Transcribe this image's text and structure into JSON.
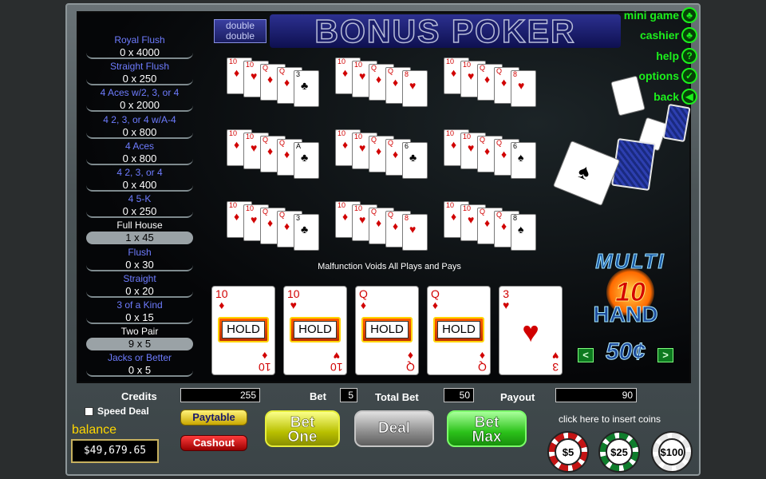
{
  "title": {
    "small_line1": "double",
    "small_line2": "double",
    "main": "BONUS POKER"
  },
  "paytable": [
    {
      "name": "Royal Flush",
      "payout": "0 x 4000",
      "active": false
    },
    {
      "name": "Straight Flush",
      "payout": "0 x 250",
      "active": false
    },
    {
      "name": "4 Aces w/2, 3, or 4",
      "payout": "0 x 2000",
      "active": false
    },
    {
      "name": "4 2, 3, or 4 w/A-4",
      "payout": "0 x 800",
      "active": false
    },
    {
      "name": "4 Aces",
      "payout": "0 x 800",
      "active": false
    },
    {
      "name": "4 2, 3, or 4",
      "payout": "0 x 400",
      "active": false
    },
    {
      "name": "4 5-K",
      "payout": "0 x 250",
      "active": false
    },
    {
      "name": "Full House",
      "payout": "1 x 45",
      "active": true
    },
    {
      "name": "Flush",
      "payout": "0 x 30",
      "active": false
    },
    {
      "name": "Straight",
      "payout": "0 x 20",
      "active": false
    },
    {
      "name": "3 of a Kind",
      "payout": "0 x 15",
      "active": false
    },
    {
      "name": "Two Pair",
      "payout": "9 x 5",
      "active": true
    },
    {
      "name": "Jacks or Better",
      "payout": "0 x 5",
      "active": false
    }
  ],
  "menu": [
    {
      "label": "mini game",
      "icon": "clover-icon",
      "glyph": "♣"
    },
    {
      "label": "cashier",
      "icon": "clover-icon",
      "glyph": "♣"
    },
    {
      "label": "help",
      "icon": "question-icon",
      "glyph": "?"
    },
    {
      "label": "options",
      "icon": "check-icon",
      "glyph": "✓"
    },
    {
      "label": "back",
      "icon": "back-arrow-icon",
      "glyph": "◀"
    }
  ],
  "notice": "Malfunction Voids All Plays and Pays",
  "main_hand": [
    {
      "rank": "10",
      "suit": "♦",
      "color": "red",
      "held": true
    },
    {
      "rank": "10",
      "suit": "♥",
      "color": "red",
      "held": true
    },
    {
      "rank": "Q",
      "suit": "♦",
      "color": "red",
      "held": true
    },
    {
      "rank": "Q",
      "suit": "♦",
      "color": "red",
      "held": true
    },
    {
      "rank": "3",
      "suit": "♥",
      "color": "red",
      "held": false
    }
  ],
  "hold_label": "HOLD",
  "mini_hands": [
    {
      "last": {
        "rank": "3",
        "suit": "♣",
        "color": "black"
      }
    },
    {
      "last": {
        "rank": "8",
        "suit": "♥",
        "color": "red"
      }
    },
    {
      "last": {
        "rank": "8",
        "suit": "♥",
        "color": "red"
      }
    },
    {
      "last": {
        "rank": "A",
        "suit": "♣",
        "color": "black"
      }
    },
    {
      "last": {
        "rank": "6",
        "suit": "♣",
        "color": "black"
      }
    },
    {
      "last": {
        "rank": "6",
        "suit": "♠",
        "color": "black"
      }
    },
    {
      "last": {
        "rank": "3",
        "suit": "♣",
        "color": "black"
      }
    },
    {
      "last": {
        "rank": "8",
        "suit": "♥",
        "color": "red"
      }
    },
    {
      "last": {
        "rank": "8",
        "suit": "♠",
        "color": "black"
      }
    }
  ],
  "logo": {
    "multi": "MULTI",
    "count": "10",
    "hand": "HAND"
  },
  "denomination": "50¢",
  "bottom": {
    "credits_label": "Credits",
    "credits_value": "255",
    "bet_label": "Bet",
    "bet_value": "5",
    "total_bet_label": "Total Bet",
    "total_bet_value": "50",
    "payout_label": "Payout",
    "payout_value": "90",
    "speed_deal_label": "Speed Deal",
    "paytable_label": "Paytable",
    "cashout_label": "Cashout",
    "balance_label": "balance",
    "balance_value": "$49,679.65",
    "bet_one_label": "Bet One",
    "deal_label": "Deal",
    "bet_max_label": "Bet Max",
    "insert_coins_text": "click here to insert coins"
  },
  "chips": [
    {
      "label": "$5",
      "color": "#c41414"
    },
    {
      "label": "$25",
      "color": "#0f7d2c"
    },
    {
      "label": "$100",
      "color": "#e8e8e8"
    }
  ]
}
